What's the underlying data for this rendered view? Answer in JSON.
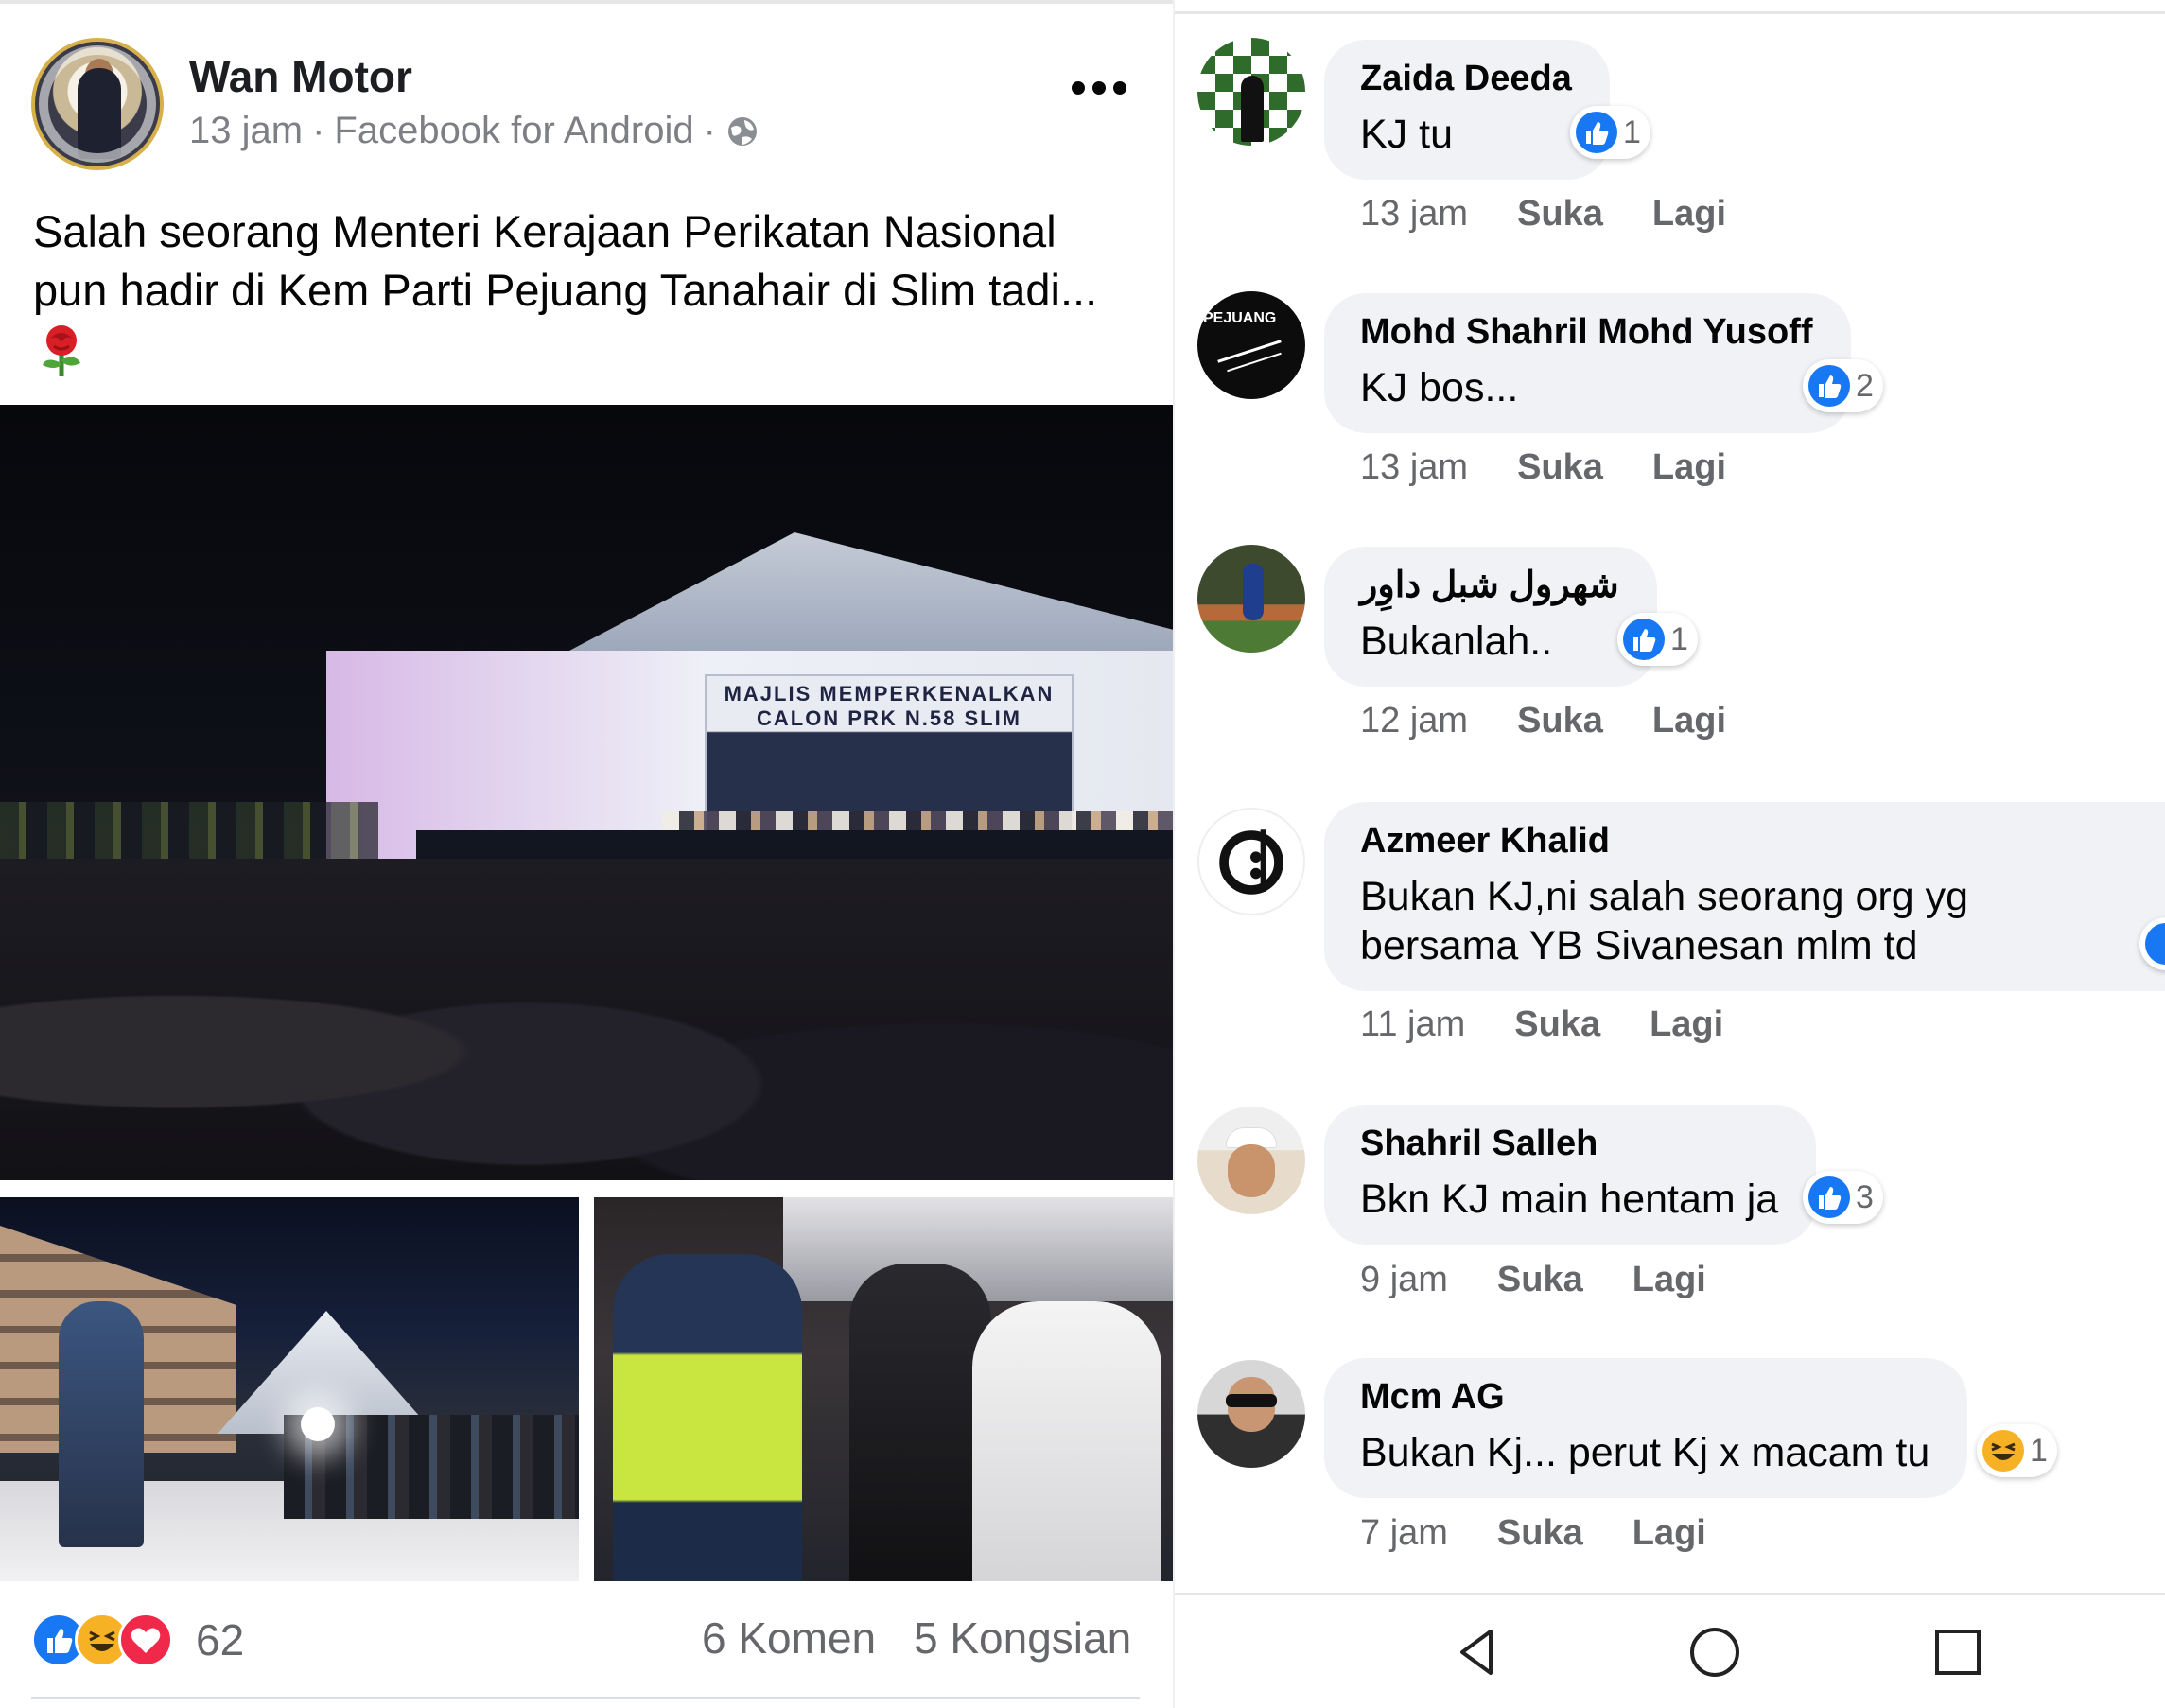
{
  "post": {
    "author": "Wan Motor",
    "time": "13 jam",
    "separator": "·",
    "source": "Facebook for Android",
    "caption_line1": "Salah seorang Menteri Kerajaan Perikatan Nasional",
    "caption_line2": "pun hadir di Kem Parti Pejuang Tanahair di Slim tadi...",
    "banner_line1": "MAJLIS MEMPERKENALKAN",
    "banner_line2": "CALON PRK N.58 SLIM",
    "reaction_icons": [
      "like-icon",
      "haha-icon",
      "love-icon"
    ],
    "reaction_count": "62",
    "comments_count": "6 Komen",
    "shares_count": "5 Kongsian"
  },
  "comments": [
    {
      "name": "Zaida Deeda",
      "text": "KJ tu",
      "reaction": "like-icon",
      "reaction_count": "1",
      "time": "13 jam",
      "like": "Suka",
      "more": "Lagi"
    },
    {
      "name": "Mohd Shahril Mohd Yusoff",
      "text": "KJ bos...",
      "reaction": "like-icon",
      "reaction_count": "2",
      "time": "13 jam",
      "like": "Suka",
      "more": "Lagi",
      "avatar_text": "PEJUANG"
    },
    {
      "name": "شهرول شبل داوِر",
      "text": "Bukanlah..",
      "reaction": "like-icon",
      "reaction_count": "1",
      "time": "12 jam",
      "like": "Suka",
      "more": "Lagi"
    },
    {
      "name": "Azmeer Khalid",
      "text_line1": "Bukan KJ,ni salah seorang org yg",
      "text_line2": "bersama YB Sivanesan mlm td",
      "reaction": "like-icon",
      "time": "11 jam",
      "like": "Suka",
      "more": "Lagi"
    },
    {
      "name": "Shahril Salleh",
      "text": "Bkn KJ main hentam ja",
      "reaction": "like-icon",
      "reaction_count": "3",
      "time": "9 jam",
      "like": "Suka",
      "more": "Lagi"
    },
    {
      "name": "Mcm AG",
      "text": "Bukan Kj... perut Kj x macam tu",
      "reaction": "haha-icon",
      "reaction_count": "1",
      "time": "7 jam",
      "like": "Suka",
      "more": "Lagi"
    }
  ],
  "colors": {
    "like_blue": "#1877f2",
    "haha_yellow": "#f7b125",
    "love_red": "#f0284a",
    "bubble_gray": "#f0f2f5",
    "meta_gray": "#65676b"
  },
  "navbar": [
    "back-icon",
    "home-icon",
    "recents-icon"
  ]
}
